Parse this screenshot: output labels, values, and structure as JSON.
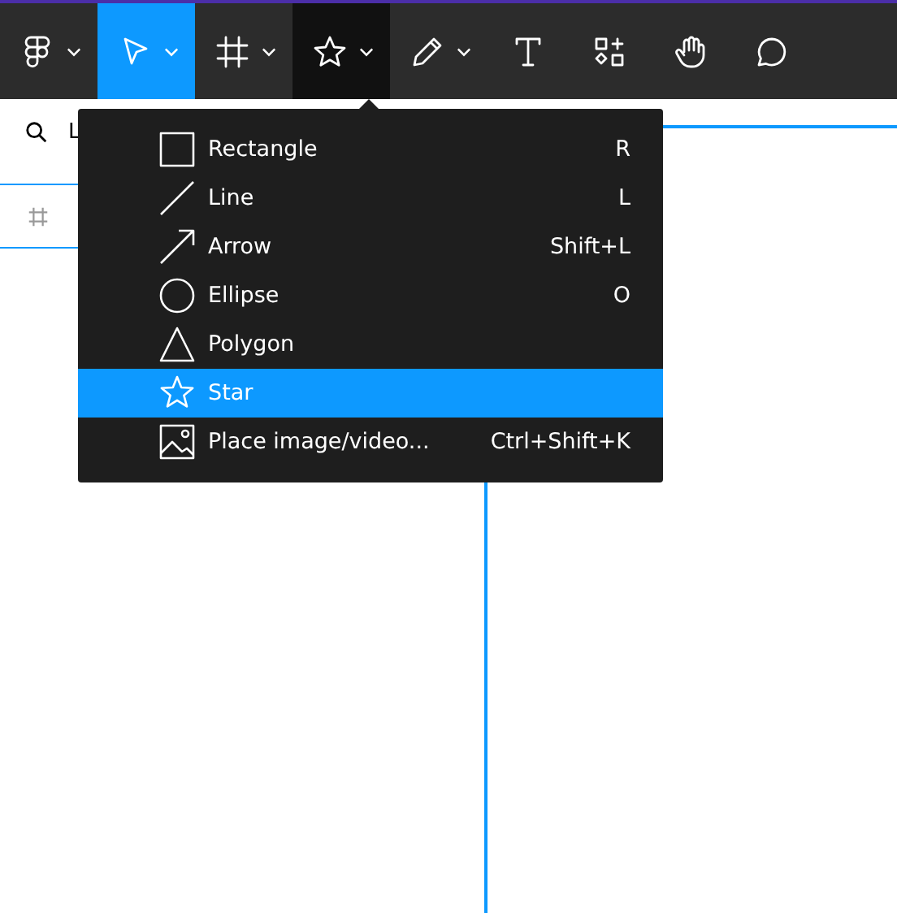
{
  "toolbar": {
    "tools": [
      {
        "kind": "logo",
        "selected": false,
        "expanded": false,
        "dropdown": true
      },
      {
        "kind": "move",
        "selected": true,
        "expanded": false,
        "dropdown": true
      },
      {
        "kind": "frame",
        "selected": false,
        "expanded": false,
        "dropdown": true
      },
      {
        "kind": "star",
        "selected": false,
        "expanded": true,
        "dropdown": true
      },
      {
        "kind": "pen",
        "selected": false,
        "expanded": false,
        "dropdown": true
      },
      {
        "kind": "text",
        "selected": false,
        "expanded": false,
        "dropdown": false
      },
      {
        "kind": "resources",
        "selected": false,
        "expanded": false,
        "dropdown": false
      },
      {
        "kind": "hand",
        "selected": false,
        "expanded": false,
        "dropdown": false
      },
      {
        "kind": "comment",
        "selected": false,
        "expanded": false,
        "dropdown": false
      }
    ]
  },
  "left_panel": {
    "search": {
      "value": "L"
    },
    "layers": [
      {
        "selected": true
      }
    ]
  },
  "shape_menu": {
    "items": [
      {
        "kind": "rectangle",
        "label": "Rectangle",
        "shortcut": "R",
        "selected": false
      },
      {
        "kind": "line",
        "label": "Line",
        "shortcut": "L",
        "selected": false
      },
      {
        "kind": "arrow",
        "label": "Arrow",
        "shortcut": "Shift+L",
        "selected": false
      },
      {
        "kind": "ellipse",
        "label": "Ellipse",
        "shortcut": "O",
        "selected": false
      },
      {
        "kind": "polygon",
        "label": "Polygon",
        "selected": false
      },
      {
        "kind": "star",
        "label": "Star",
        "selected": true
      },
      {
        "kind": "image",
        "label": "Place image/video...",
        "shortcut": "Ctrl+Shift+K",
        "selected": false
      }
    ]
  }
}
